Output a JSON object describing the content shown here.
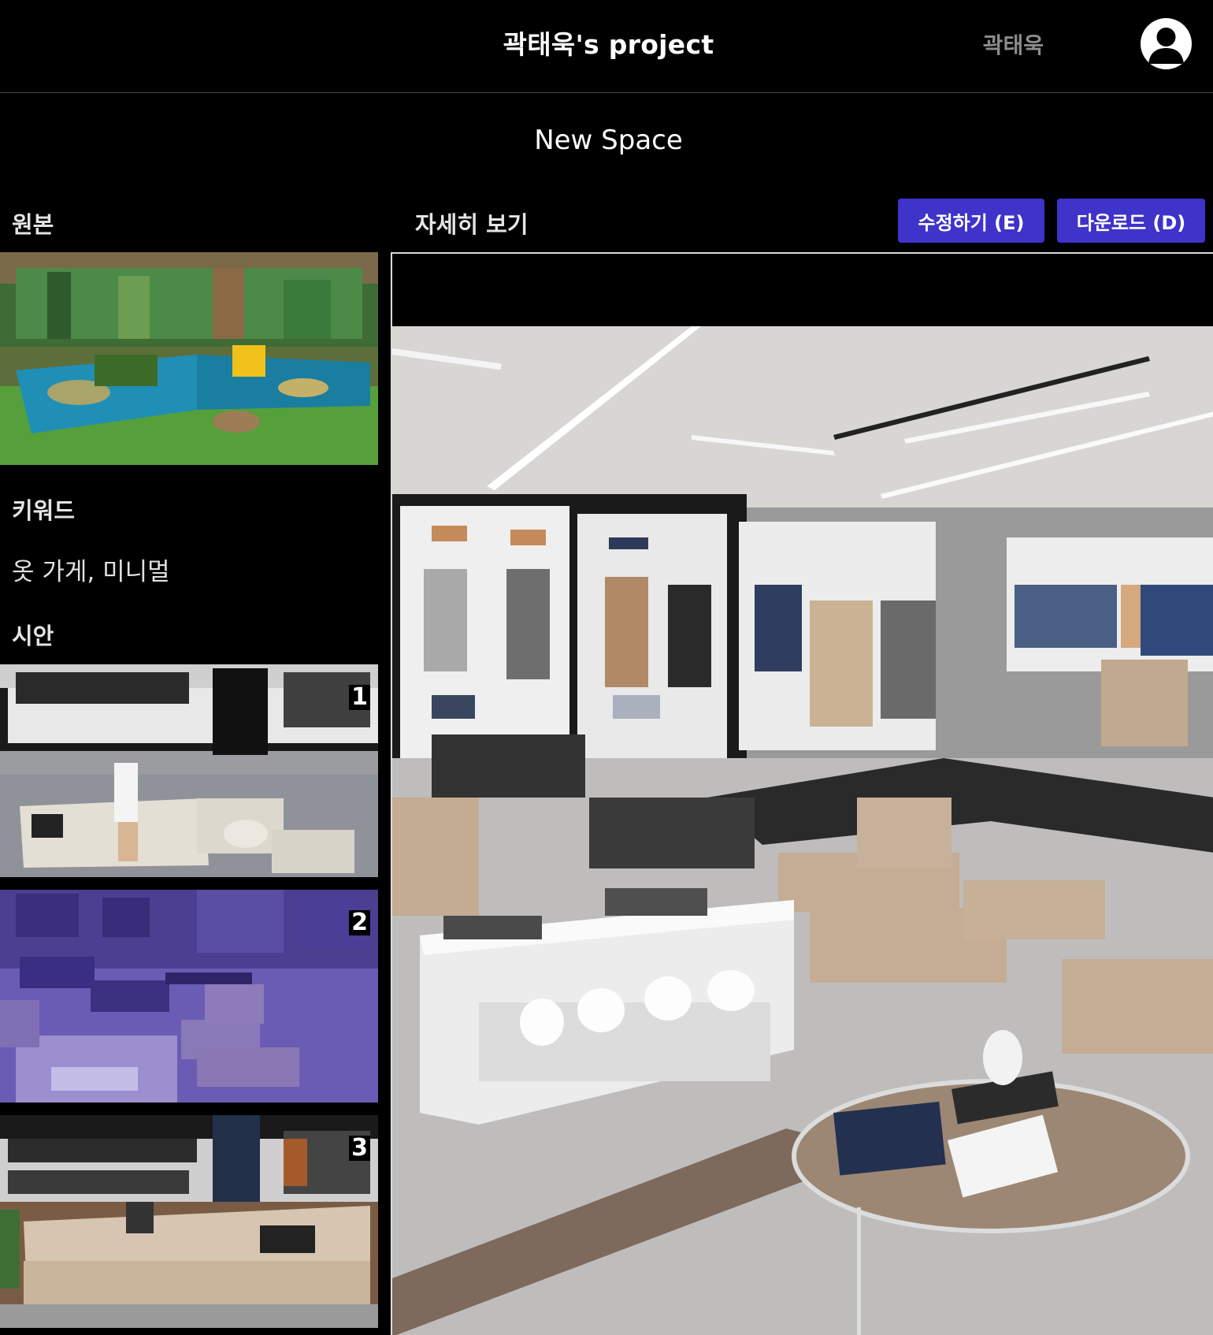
{
  "header": {
    "project_title": "곽태욱's project",
    "user_name": "곽태욱",
    "avatar_icon": "user-avatar-icon"
  },
  "space": {
    "title": "New Space"
  },
  "original": {
    "label": "원본"
  },
  "keywords": {
    "label": "키워드",
    "value": "옷 가게, 미니멀"
  },
  "drafts": {
    "label": "시안",
    "items": [
      {
        "number": "1"
      },
      {
        "number": "2"
      },
      {
        "number": "3"
      }
    ],
    "selected_number": "2"
  },
  "detail": {
    "label": "자세히 보기",
    "edit_label": "수정하기 (E)",
    "download_label": "다운로드 (D)"
  },
  "colors": {
    "accent": "#3f33c9",
    "background": "#000000",
    "selected_overlay": "#4a3aa8"
  }
}
